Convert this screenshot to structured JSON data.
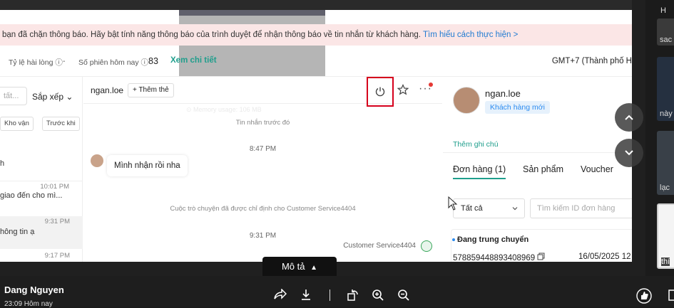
{
  "banner": {
    "text": "bạn đã chặn thông báo. Hãy bật tính năng thông báo của trình duyệt để nhận thông báo về tin nhắn từ khách hàng.",
    "link": "Tìm hiểu cách thực hiện >"
  },
  "stats": {
    "satisfaction_label": "Tỷ lệ hài lòng ⓘ",
    "satisfaction_value": "-",
    "sessions_label": "Số phiên hôm nay ⓘ",
    "sessions_value": "83",
    "view_detail": "Xem chi tiết",
    "timezone": "GMT+7 (Thành phố H"
  },
  "left_panel": {
    "search_placeholder": "tất...",
    "sort_label": "Sắp xếp ⌄",
    "chips": [
      "Kho vận",
      "Trước khi"
    ],
    "conversations": [
      {
        "snippet": "h",
        "time": ""
      },
      {
        "snippet": "giao đến cho mì...",
        "time": "10:01 PM"
      },
      {
        "snippet": "hông tin ạ",
        "time": "9:31 PM"
      },
      {
        "snippet": "",
        "time": "9:17 PM"
      }
    ]
  },
  "chat": {
    "customer_name": "ngan.loe",
    "add_tag": "Thêm thẻ",
    "earlier_messages": "Tin nhắn trước đó",
    "time_1": "8:47 PM",
    "message_1": "Mình nhận rồi nha",
    "system_assign": "Cuộc trò chuyện đã được chỉ định cho Customer Service4404",
    "time_2": "9:31 PM",
    "agent_name": "Customer Service4404"
  },
  "overlay": {
    "memory_usage": "Memory usage: 106 MB"
  },
  "customer_panel": {
    "name": "ngan.loe",
    "tag": "Khách hàng mới",
    "add_note": "Thêm ghi chú",
    "tabs": [
      "Đơn hàng (1)",
      "Sản phẩm",
      "Voucher"
    ],
    "filter_value": "Tất cả",
    "order_search_placeholder": "Tìm kiếm ID đơn hàng",
    "order": {
      "status": "Đang trung chuyển",
      "id": "578859448893408969",
      "date": "16/05/2025 12"
    }
  },
  "viewer": {
    "description_tab": "Mô tả",
    "author": "Dang Nguyen",
    "posted_time": "23:09 Hôm nay",
    "thumb_labels": [
      "H",
      "sac",
      "này",
      "lạc",
      "thí"
    ],
    "colors": {
      "accent_teal": "#1f9e8c",
      "link_blue": "#1f7ad1",
      "highlight_red": "#d6001c"
    }
  }
}
